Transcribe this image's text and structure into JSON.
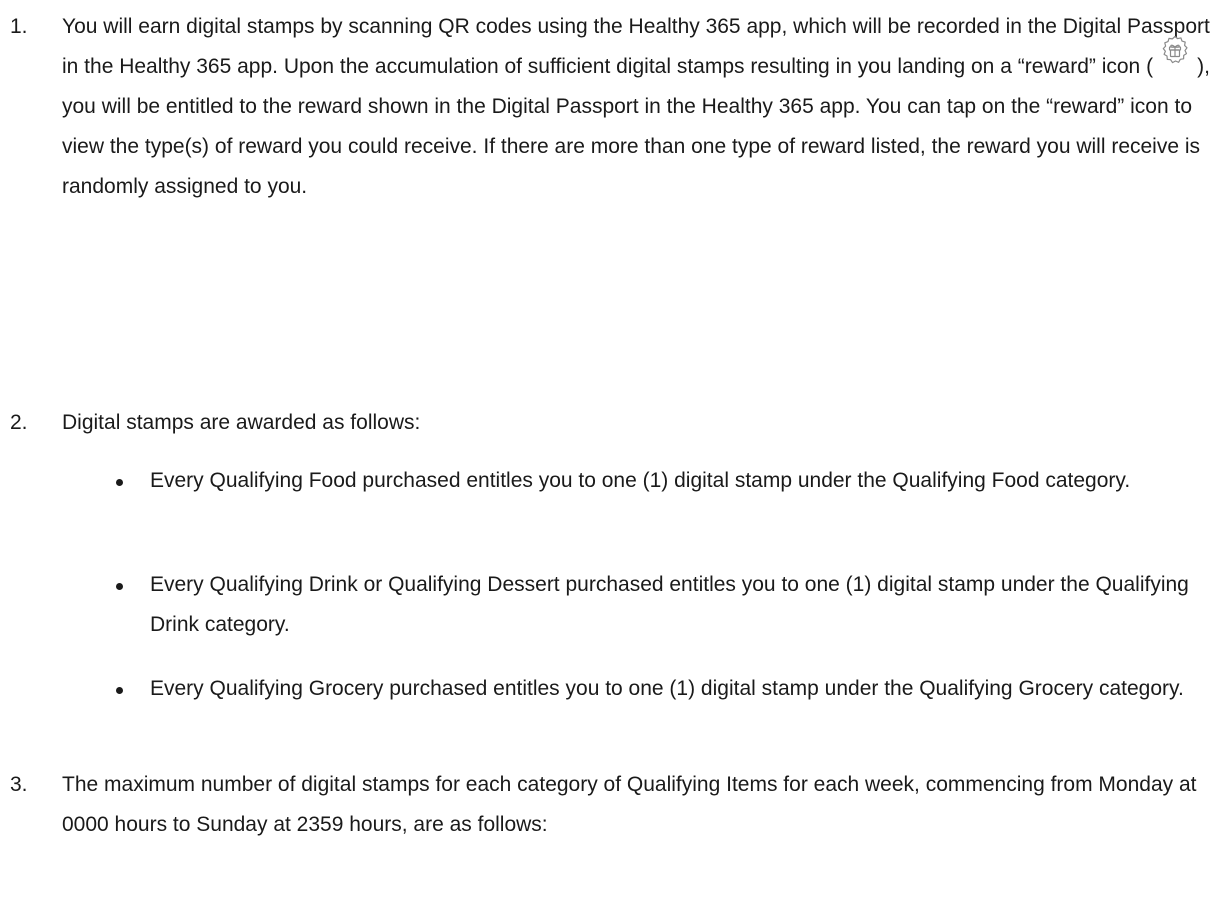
{
  "items": [
    {
      "number": "1.",
      "text_before_icon": "You will earn digital stamps by scanning QR codes using the Healthy 365 app, which will be recorded in the Digital Passport in the Healthy 365 app. Upon the accumulation of sufficient digital stamps resulting in you landing on a “reward” icon (",
      "icon": "reward-gift-icon",
      "text_after_icon": "), you will be entitled to the reward shown in the Digital Passport in the Healthy 365 app. You can tap on the “reward” icon to view the type(s) of reward you could receive. If there are more than one type of reward listed, the reward you will receive is randomly assigned to you."
    },
    {
      "number": "2.",
      "text": "Digital stamps are awarded as follows:",
      "bullets": [
        "Every Qualifying Food purchased entitles you to one (1) digital stamp under the Qualifying Food category.",
        "Every Qualifying Drink or Qualifying Dessert purchased entitles you to one (1) digital stamp under the Qualifying Drink category.",
        "Every Qualifying Grocery purchased entitles you to one (1) digital stamp under the Qualifying Grocery category."
      ]
    },
    {
      "number": "3.",
      "text": "The maximum number of digital stamps for each category of Qualifying Items for each week, commencing from Monday at 0000 hours to Sunday at 2359 hours, are as follows:"
    }
  ],
  "colors": {
    "text": "#1a1a1a",
    "icon_stroke": "#8a8a8a",
    "background": "#ffffff"
  }
}
